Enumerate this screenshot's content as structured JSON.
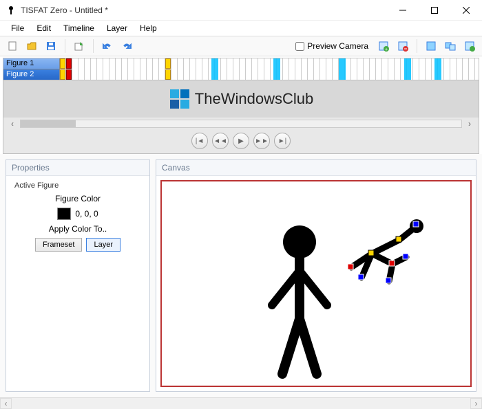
{
  "window": {
    "title": "TISFAT Zero - Untitled *"
  },
  "menu": {
    "items": [
      "File",
      "Edit",
      "Timeline",
      "Layer",
      "Help"
    ]
  },
  "toolbar": {
    "preview_camera_label": "Preview Camera",
    "preview_camera_checked": false
  },
  "timeline": {
    "layers": [
      "Figure 1",
      "Figure 2"
    ]
  },
  "watermark": {
    "text": "TheWindowsClub"
  },
  "playback": {
    "buttons": [
      "skip-start",
      "step-back",
      "play",
      "step-forward",
      "skip-end"
    ]
  },
  "properties": {
    "panel_title": "Properties",
    "active_label": "Active Figure",
    "figure_color_label": "Figure Color",
    "figure_color_value": "0, 0, 0",
    "figure_color_hex": "#000000",
    "apply_label": "Apply Color To..",
    "frameset_btn": "Frameset",
    "layer_btn": "Layer"
  },
  "canvas": {
    "panel_title": "Canvas"
  },
  "colors": {
    "accent": "#3a80e0",
    "timeline_key_yellow": "#ffd400",
    "timeline_key_red": "#d00",
    "playhead": "#00c0ff",
    "canvas_border": "#b33"
  }
}
